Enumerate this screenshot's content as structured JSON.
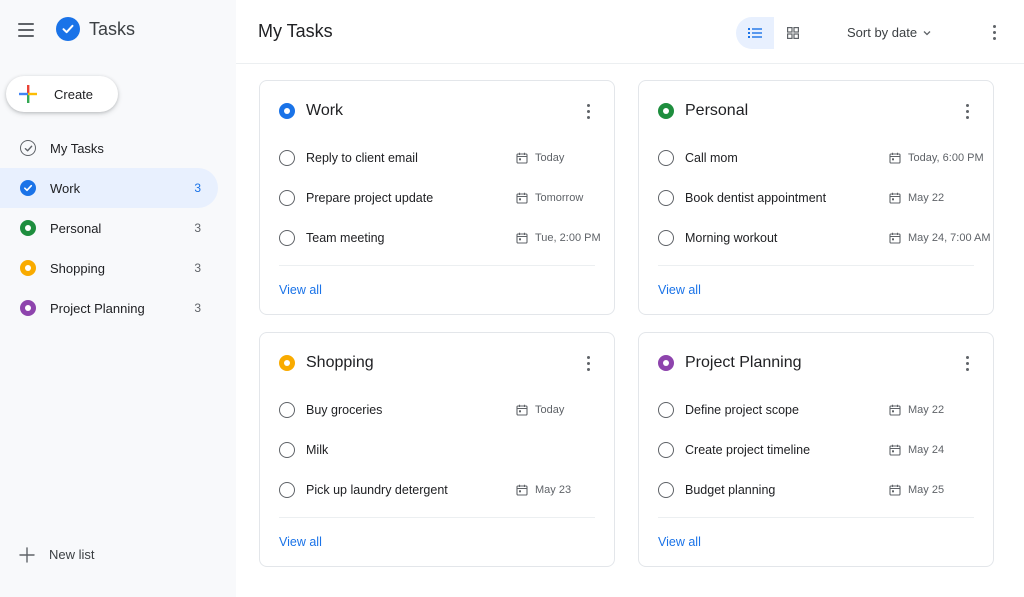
{
  "app": {
    "title": "Tasks",
    "logo_icon": "check-circle-icon",
    "brand_color": "#1a73e8"
  },
  "sidebar": {
    "create_label": "Create",
    "items": [
      {
        "label": "My Tasks",
        "count": "",
        "icon": "check-circle-outline-icon",
        "color": "#5f6368",
        "active": false
      },
      {
        "label": "Work",
        "count": "3",
        "icon": "check-circle-icon",
        "color": "#1a73e8",
        "active": true
      },
      {
        "label": "Personal",
        "count": "3",
        "icon": "dot-ring-icon",
        "color": "#1e8e3e",
        "active": false
      },
      {
        "label": "Shopping",
        "count": "3",
        "icon": "dot-ring-icon",
        "color": "#f9ab00",
        "active": false
      },
      {
        "label": "Project Planning",
        "count": "3",
        "icon": "dot-ring-icon",
        "color": "#8e44ad",
        "active": false
      }
    ],
    "new_list_label": "New list"
  },
  "header": {
    "title": "My Tasks",
    "view_modes": [
      "list-view-icon",
      "grid-view-icon"
    ],
    "active_view": "list",
    "sort_label": "Sort by date"
  },
  "cards": [
    {
      "title": "Work",
      "color": "#1a73e8",
      "tasks": [
        {
          "label": "Reply to client email",
          "date": "Today"
        },
        {
          "label": "Prepare project update",
          "date": "Tomorrow"
        },
        {
          "label": "Team meeting",
          "date": "Tue, 2:00 PM"
        }
      ],
      "view_all": "View all"
    },
    {
      "title": "Personal",
      "color": "#1e8e3e",
      "tasks": [
        {
          "label": "Call mom",
          "date": "Today, 6:00 PM"
        },
        {
          "label": "Book dentist appointment",
          "date": "May 22"
        },
        {
          "label": "Morning workout",
          "date": "May 24, 7:00 AM"
        }
      ],
      "view_all": "View all"
    },
    {
      "title": "Shopping",
      "color": "#f9ab00",
      "tasks": [
        {
          "label": "Buy groceries",
          "date": "Today"
        },
        {
          "label": "Milk",
          "date": ""
        },
        {
          "label": "Pick up laundry detergent",
          "date": "May 23"
        }
      ],
      "view_all": "View all"
    },
    {
      "title": "Project Planning",
      "color": "#8e44ad",
      "tasks": [
        {
          "label": "Define project scope",
          "date": "May 22"
        },
        {
          "label": "Create project timeline",
          "date": "May 24"
        },
        {
          "label": "Budget planning",
          "date": "May 25"
        }
      ],
      "view_all": "View all"
    }
  ]
}
